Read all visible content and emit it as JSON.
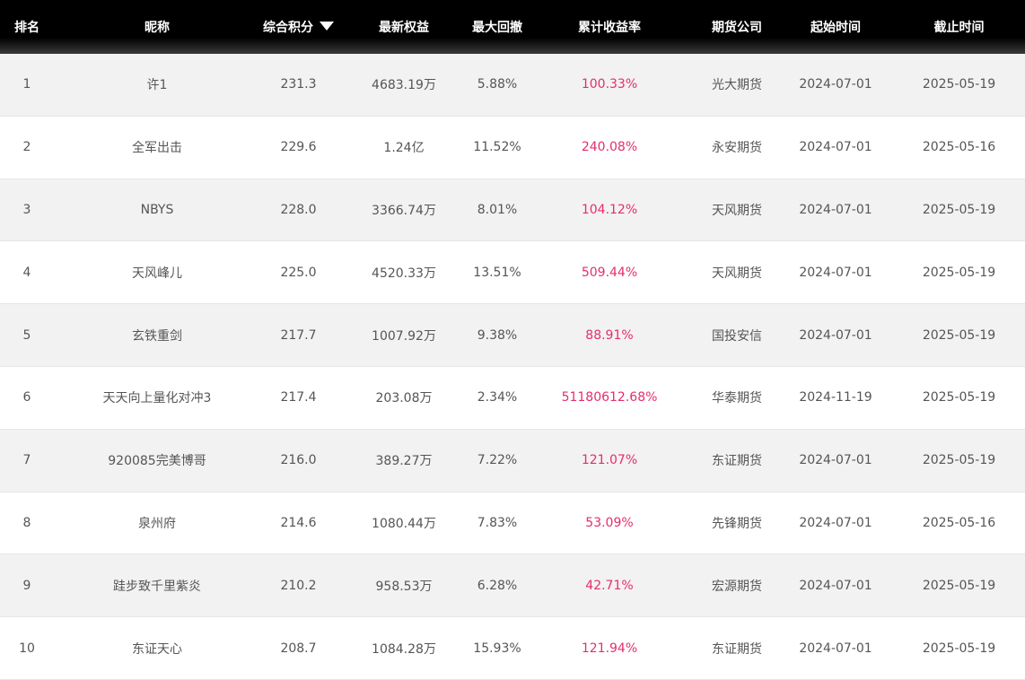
{
  "header": {
    "rank": "排名",
    "name": "昵称",
    "score": "综合积分",
    "equity": "最新权益",
    "drawdown": "最大回撤",
    "return": "累计收益率",
    "firm": "期货公司",
    "start": "起始时间",
    "end": "截止时间"
  },
  "sort_icon": "sort-desc-triangle-icon",
  "colors": {
    "header_bg": "#000000",
    "return_text": "#e62e6b",
    "odd_row_bg": "#f2f2f2"
  },
  "rows": [
    {
      "rank": "1",
      "name": "许1",
      "score": "231.3",
      "equity": "4683.19万",
      "drawdown": "5.88%",
      "return": "100.33%",
      "firm": "光大期货",
      "start": "2024-07-01",
      "end": "2025-05-19"
    },
    {
      "rank": "2",
      "name": "全军出击",
      "score": "229.6",
      "equity": "1.24亿",
      "drawdown": "11.52%",
      "return": "240.08%",
      "firm": "永安期货",
      "start": "2024-07-01",
      "end": "2025-05-16"
    },
    {
      "rank": "3",
      "name": "NBYS",
      "score": "228.0",
      "equity": "3366.74万",
      "drawdown": "8.01%",
      "return": "104.12%",
      "firm": "天风期货",
      "start": "2024-07-01",
      "end": "2025-05-19"
    },
    {
      "rank": "4",
      "name": "天风峰儿",
      "score": "225.0",
      "equity": "4520.33万",
      "drawdown": "13.51%",
      "return": "509.44%",
      "firm": "天风期货",
      "start": "2024-07-01",
      "end": "2025-05-19"
    },
    {
      "rank": "5",
      "name": "玄铁重剑",
      "score": "217.7",
      "equity": "1007.92万",
      "drawdown": "9.38%",
      "return": "88.91%",
      "firm": "国投安信",
      "start": "2024-07-01",
      "end": "2025-05-19"
    },
    {
      "rank": "6",
      "name": "天天向上量化对冲3",
      "score": "217.4",
      "equity": "203.08万",
      "drawdown": "2.34%",
      "return": "51180612.68%",
      "firm": "华泰期货",
      "start": "2024-11-19",
      "end": "2025-05-19"
    },
    {
      "rank": "7",
      "name": "920085完美博哥",
      "score": "216.0",
      "equity": "389.27万",
      "drawdown": "7.22%",
      "return": "121.07%",
      "firm": "东证期货",
      "start": "2024-07-01",
      "end": "2025-05-19"
    },
    {
      "rank": "8",
      "name": "泉州府",
      "score": "214.6",
      "equity": "1080.44万",
      "drawdown": "7.83%",
      "return": "53.09%",
      "firm": "先锋期货",
      "start": "2024-07-01",
      "end": "2025-05-16"
    },
    {
      "rank": "9",
      "name": "跬步致千里紫炎",
      "score": "210.2",
      "equity": "958.53万",
      "drawdown": "6.28%",
      "return": "42.71%",
      "firm": "宏源期货",
      "start": "2024-07-01",
      "end": "2025-05-19"
    },
    {
      "rank": "10",
      "name": "东证天心",
      "score": "208.7",
      "equity": "1084.28万",
      "drawdown": "15.93%",
      "return": "121.94%",
      "firm": "东证期货",
      "start": "2024-07-01",
      "end": "2025-05-19"
    }
  ]
}
